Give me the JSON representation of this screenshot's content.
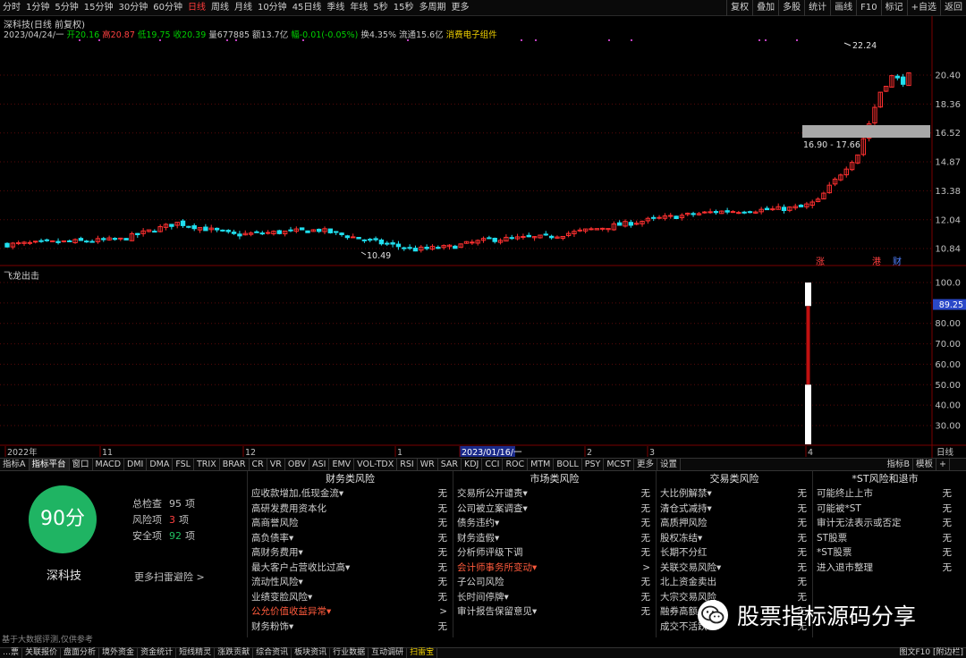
{
  "topbar": {
    "periods": [
      "分时",
      "1分钟",
      "5分钟",
      "15分钟",
      "30分钟",
      "60分钟",
      "日线",
      "周线",
      "月线",
      "10分钟",
      "45日线",
      "季线",
      "年线",
      "5秒",
      "15秒",
      "多周期",
      "更多"
    ],
    "active_period": "日线",
    "right": [
      "复权",
      "叠加",
      "多股",
      "统计",
      "画线",
      "F10",
      "标记",
      "+自选",
      "返回"
    ]
  },
  "main_chart": {
    "title": "深科技(日线 前复权)",
    "info": [
      {
        "text": "2023/04/24/一",
        "color": "#c8c8c8"
      },
      {
        "text": "开20.16",
        "color": "#00d000"
      },
      {
        "text": "高20.87",
        "color": "#ff4040"
      },
      {
        "text": "低19.75",
        "color": "#00d000"
      },
      {
        "text": "收20.39",
        "color": "#00d000"
      },
      {
        "text": "量677885",
        "color": "#c8c8c8"
      },
      {
        "text": "额13.7亿",
        "color": "#c8c8c8"
      },
      {
        "text": "幅-0.01(-0.05%)",
        "color": "#00d000"
      },
      {
        "text": "换4.35%",
        "color": "#c8c8c8"
      },
      {
        "text": "流通15.6亿",
        "color": "#c8c8c8"
      },
      {
        "text": "消费电子组件",
        "color": "#f0d000"
      }
    ],
    "price_ticks": [
      "20.40",
      "18.36",
      "16.52",
      "14.87",
      "13.38",
      "12.04",
      "10.84"
    ],
    "annotations": {
      "high": "22.24",
      "low": "10.49",
      "range": "16.90 - 17.66"
    },
    "event_labels": [
      "涨",
      "港",
      "财"
    ]
  },
  "sub_chart": {
    "title": "飞龙出击",
    "ticks": [
      "100.0",
      "90.00",
      "80.00",
      "70.00",
      "60.00",
      "50.00",
      "40.00",
      "30.00"
    ],
    "current": "89.25",
    "bar_value": 89.25
  },
  "date_axis": {
    "labels": [
      "2022年",
      "11",
      "12",
      "1",
      "2023/01/16/一",
      "2",
      "3",
      "4"
    ],
    "right_label": "日线"
  },
  "indicator_tabs": {
    "items": [
      "指标A",
      "指标平台",
      "窗口",
      "MACD",
      "DMI",
      "DMA",
      "FSL",
      "TRIX",
      "BRAR",
      "CR",
      "VR",
      "OBV",
      "ASI",
      "EMV",
      "VOL-TDX",
      "RSI",
      "WR",
      "SAR",
      "KDJ",
      "CCI",
      "ROC",
      "MTM",
      "BOLL",
      "PSY",
      "MCST",
      "更多",
      "设置"
    ],
    "right": [
      "指标B",
      "模板",
      "+"
    ]
  },
  "risk": {
    "score": "90分",
    "stock": "深科技",
    "stats": [
      {
        "label": "总检查",
        "value": "95",
        "unit": "项",
        "color": "#c0c0c0"
      },
      {
        "label": "风险项",
        "value": "3",
        "unit": "项",
        "color": "#ff4040"
      },
      {
        "label": "安全项",
        "value": "92",
        "unit": "项",
        "color": "#20c060"
      }
    ],
    "more": "更多扫雷避险 >",
    "note": "基于大数据评测,仅供参考",
    "columns": [
      {
        "title": "财务类风险",
        "items": [
          {
            "label": "应收款增加,低现金流▾",
            "val": "无",
            "hot": false
          },
          {
            "label": "高研发费用资本化",
            "val": "无",
            "hot": false
          },
          {
            "label": "高商誉风险",
            "val": "无",
            "hot": false
          },
          {
            "label": "高负债率▾",
            "val": "无",
            "hot": false
          },
          {
            "label": "高财务费用▾",
            "val": "无",
            "hot": false
          },
          {
            "label": "最大客户占营收比过高▾",
            "val": "无",
            "hot": false
          },
          {
            "label": "流动性风险▾",
            "val": "无",
            "hot": false
          },
          {
            "label": "业绩变脸风险▾",
            "val": "无",
            "hot": false
          },
          {
            "label": "公允价值收益异常▾",
            "val": ">",
            "hot": true
          },
          {
            "label": "财务粉饰▾",
            "val": "无",
            "hot": false
          }
        ]
      },
      {
        "title": "市场类风险",
        "items": [
          {
            "label": "交易所公开谴责▾",
            "val": "无",
            "hot": false
          },
          {
            "label": "公司被立案调查▾",
            "val": "无",
            "hot": false
          },
          {
            "label": "债务违约▾",
            "val": "无",
            "hot": false
          },
          {
            "label": "财务造假▾",
            "val": "无",
            "hot": false
          },
          {
            "label": "分析师评级下调",
            "val": "无",
            "hot": false
          },
          {
            "label": "会计师事务所变动▾",
            "val": ">",
            "hot": true
          },
          {
            "label": "子公司风险",
            "val": "无",
            "hot": false
          },
          {
            "label": "长时间停牌▾",
            "val": "无",
            "hot": false
          },
          {
            "label": "审计报告保留意见▾",
            "val": "无",
            "hot": false
          }
        ]
      },
      {
        "title": "交易类风险",
        "items": [
          {
            "label": "大比例解禁▾",
            "val": "无",
            "hot": false
          },
          {
            "label": "清仓式减持▾",
            "val": "无",
            "hot": false
          },
          {
            "label": "高质押风险",
            "val": "无",
            "hot": false
          },
          {
            "label": "股权冻结▾",
            "val": "无",
            "hot": false
          },
          {
            "label": "长期不分红",
            "val": "无",
            "hot": false
          },
          {
            "label": "关联交易风险▾",
            "val": "无",
            "hot": false
          },
          {
            "label": "北上资金卖出",
            "val": "无",
            "hot": false
          },
          {
            "label": "大宗交易风险",
            "val": "无",
            "hot": false
          },
          {
            "label": "融券高额",
            "val": "无",
            "hot": false
          },
          {
            "label": "成交不活跃▾",
            "val": "无",
            "hot": false
          }
        ]
      },
      {
        "title": "*ST风险和退市",
        "items": [
          {
            "label": "可能终止上市",
            "val": "无",
            "hot": false
          },
          {
            "label": "可能被*ST",
            "val": "无",
            "hot": false
          },
          {
            "label": "审计无法表示或否定",
            "val": "无",
            "hot": false
          },
          {
            "label": "ST股票",
            "val": "无",
            "hot": false
          },
          {
            "label": "*ST股票",
            "val": "无",
            "hot": false
          },
          {
            "label": "进入退市整理",
            "val": "无",
            "hot": false
          }
        ]
      }
    ]
  },
  "status_bar": {
    "items": [
      "…票",
      "关联报价",
      "盘面分析",
      "境外资金",
      "资金统计",
      "短线精灵",
      "涨跌贡献",
      "综合资讯",
      "板块资讯",
      "行业数据",
      "互动调研",
      "扫雷宝"
    ],
    "highlight": "扫雷宝",
    "right": "图文F10 [附边栏]"
  },
  "watermark": {
    "text": "股票指标源码分享"
  },
  "colors": {
    "up": "#ff3030",
    "down": "#20e0f0",
    "score": "#1fb463",
    "grid": "#5a0a0a",
    "axis": "#7a0000"
  }
}
